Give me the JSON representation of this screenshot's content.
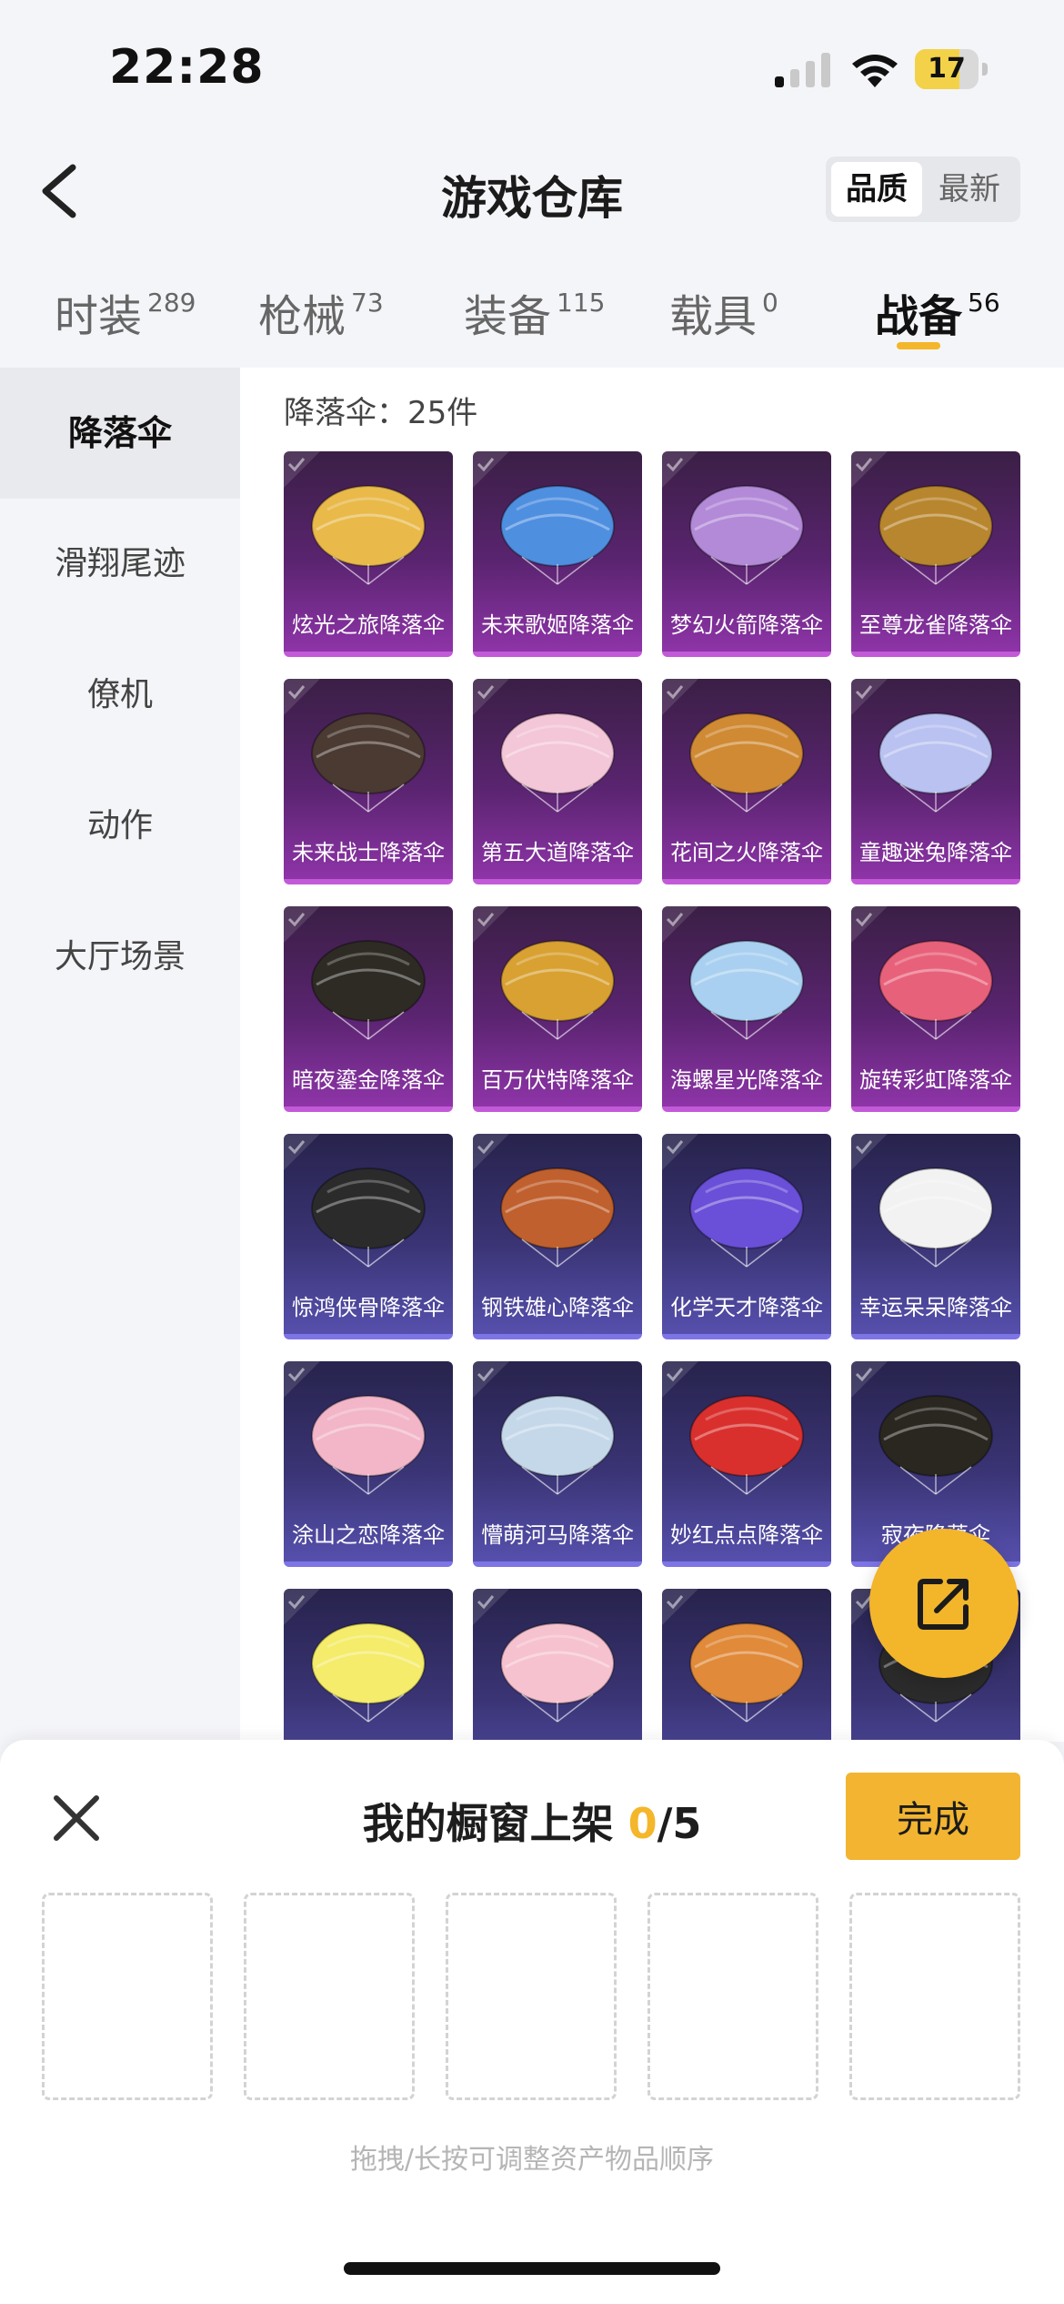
{
  "status_bar": {
    "time": "22:28",
    "battery": "17"
  },
  "header": {
    "title": "游戏仓库",
    "sort_options": [
      "品质",
      "最新"
    ],
    "sort_selected": "品质"
  },
  "tabs": [
    {
      "label": "时装",
      "count": "289"
    },
    {
      "label": "枪械",
      "count": "73"
    },
    {
      "label": "装备",
      "count": "115"
    },
    {
      "label": "载具",
      "count": "0"
    },
    {
      "label": "战备",
      "count": "56"
    }
  ],
  "active_tab": "战备",
  "sidebar": {
    "items": [
      "降落伞",
      "滑翔尾迹",
      "僚机",
      "动作",
      "大厅场景"
    ],
    "active": "降落伞"
  },
  "main": {
    "count_text": "降落伞：25件",
    "items": [
      {
        "name": "炫光之旅降落伞",
        "rarity": "purple",
        "color": "#e9b94a"
      },
      {
        "name": "未来歌姬降落伞",
        "rarity": "purple",
        "color": "#4f8fe0"
      },
      {
        "name": "梦幻火箭降落伞",
        "rarity": "purple",
        "color": "#b38ad8"
      },
      {
        "name": "至尊龙雀降落伞",
        "rarity": "purple",
        "color": "#b8862e"
      },
      {
        "name": "未来战士降落伞",
        "rarity": "purple",
        "color": "#4a3a32"
      },
      {
        "name": "第五大道降落伞",
        "rarity": "purple",
        "color": "#f3c6d8"
      },
      {
        "name": "花间之火降落伞",
        "rarity": "purple",
        "color": "#d08a34"
      },
      {
        "name": "童趣迷兔降落伞",
        "rarity": "purple",
        "color": "#b9c2f0"
      },
      {
        "name": "暗夜鎏金降落伞",
        "rarity": "purple",
        "color": "#2e2b25"
      },
      {
        "name": "百万伏特降落伞",
        "rarity": "purple",
        "color": "#d8a132"
      },
      {
        "name": "海螺星光降落伞",
        "rarity": "purple",
        "color": "#a9d0f0"
      },
      {
        "name": "旋转彩虹降落伞",
        "rarity": "purple",
        "color": "#e8617a"
      },
      {
        "name": "惊鸿侠骨降落伞",
        "rarity": "blue",
        "color": "#2b2b2b"
      },
      {
        "name": "钢铁雄心降落伞",
        "rarity": "blue",
        "color": "#c0602e"
      },
      {
        "name": "化学天才降落伞",
        "rarity": "blue",
        "color": "#6a4fd8"
      },
      {
        "name": "幸运呆呆降落伞",
        "rarity": "blue",
        "color": "#f2f2f2"
      },
      {
        "name": "涂山之恋降落伞",
        "rarity": "blue",
        "color": "#f2b6c8"
      },
      {
        "name": "懵萌河马降落伞",
        "rarity": "blue",
        "color": "#c5d8ea"
      },
      {
        "name": "妙红点点降落伞",
        "rarity": "blue",
        "color": "#d9302e"
      },
      {
        "name": "寂夜降落伞",
        "rarity": "blue",
        "color": "#2a2620"
      },
      {
        "name": "",
        "rarity": "blue",
        "color": "#f4ec6a"
      },
      {
        "name": "",
        "rarity": "blue",
        "color": "#f6c2cf"
      },
      {
        "name": "",
        "rarity": "blue",
        "color": "#e08a3a"
      },
      {
        "name": "",
        "rarity": "blue",
        "color": "#2b2b2b"
      }
    ]
  },
  "sheet": {
    "title_prefix": "我的橱窗上架",
    "current": "0",
    "max": "/5",
    "done_label": "完成",
    "slots": 5,
    "hint": "拖拽/长按可调整资产物品顺序"
  },
  "icons": {
    "back": "chevron-left-icon",
    "close": "close-icon",
    "share": "share-out-icon",
    "check": "check-icon"
  },
  "colors": {
    "accent": "#f4b62a",
    "purple_rarity": "#c25ad8",
    "blue_rarity": "#7d74e6"
  }
}
